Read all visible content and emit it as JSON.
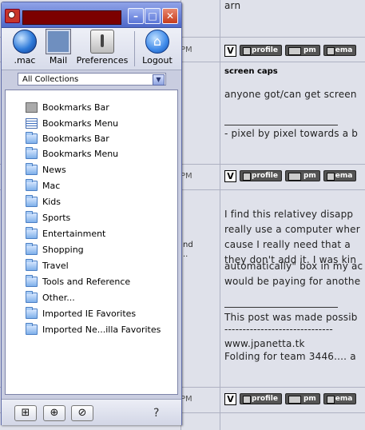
{
  "forum": {
    "timestamps": [
      "PM",
      "PM",
      "PM",
      "PM"
    ],
    "side_snippet": "nd",
    "side_snippet2": "..",
    "post1_tail": "arn",
    "post2": {
      "title": "screen caps",
      "line1": "anyone got/can get screen",
      "sig": "- pixel by pixel towards a b"
    },
    "post3": {
      "lines": [
        "I find this relativey disapp",
        "really use a computer wher",
        "cause I really need that a",
        "they don't add it. I was kin",
        "automatically\" box in my ac",
        "would be paying for anothe"
      ],
      "sig_lines": [
        "This post was made possib",
        "------------------------------",
        "www.jpanetta.tk",
        "Folding for team 3446.... a"
      ]
    },
    "buttons": {
      "badge": "V",
      "profile": "profile",
      "pm": "pm",
      "email": "ema"
    }
  },
  "window": {
    "title": "",
    "titlebar_buttons": [
      "–",
      "□",
      "✕"
    ],
    "toolbar": [
      {
        "label": ".mac",
        "icon": "mac-globe-icon"
      },
      {
        "label": "Mail",
        "icon": "mail-stamp-icon"
      },
      {
        "label": "Preferences",
        "icon": "preferences-switch-icon"
      },
      {
        "label": "Logout",
        "icon": "logout-home-icon"
      }
    ],
    "collection_select": {
      "value": "All Collections"
    },
    "bookmarks": [
      {
        "label": "Bookmarks Bar",
        "icon": "bookmarks-bar-icon"
      },
      {
        "label": "Bookmarks Menu",
        "icon": "bookmarks-menu-icon"
      },
      {
        "label": "Bookmarks Bar",
        "icon": "folder-icon"
      },
      {
        "label": "Bookmarks Menu",
        "icon": "folder-icon"
      },
      {
        "label": "News",
        "icon": "folder-icon"
      },
      {
        "label": "Mac",
        "icon": "folder-icon"
      },
      {
        "label": "Kids",
        "icon": "folder-icon"
      },
      {
        "label": "Sports",
        "icon": "folder-icon"
      },
      {
        "label": "Entertainment",
        "icon": "folder-icon"
      },
      {
        "label": "Shopping",
        "icon": "folder-icon"
      },
      {
        "label": "Travel",
        "icon": "folder-icon"
      },
      {
        "label": "Tools and Reference",
        "icon": "folder-icon"
      },
      {
        "label": "Other...",
        "icon": "folder-icon"
      },
      {
        "label": "Imported IE Favorites",
        "icon": "folder-icon"
      },
      {
        "label": "Imported Ne...illa Favorites",
        "icon": "folder-icon"
      }
    ],
    "bottom": {
      "help": "?"
    }
  }
}
